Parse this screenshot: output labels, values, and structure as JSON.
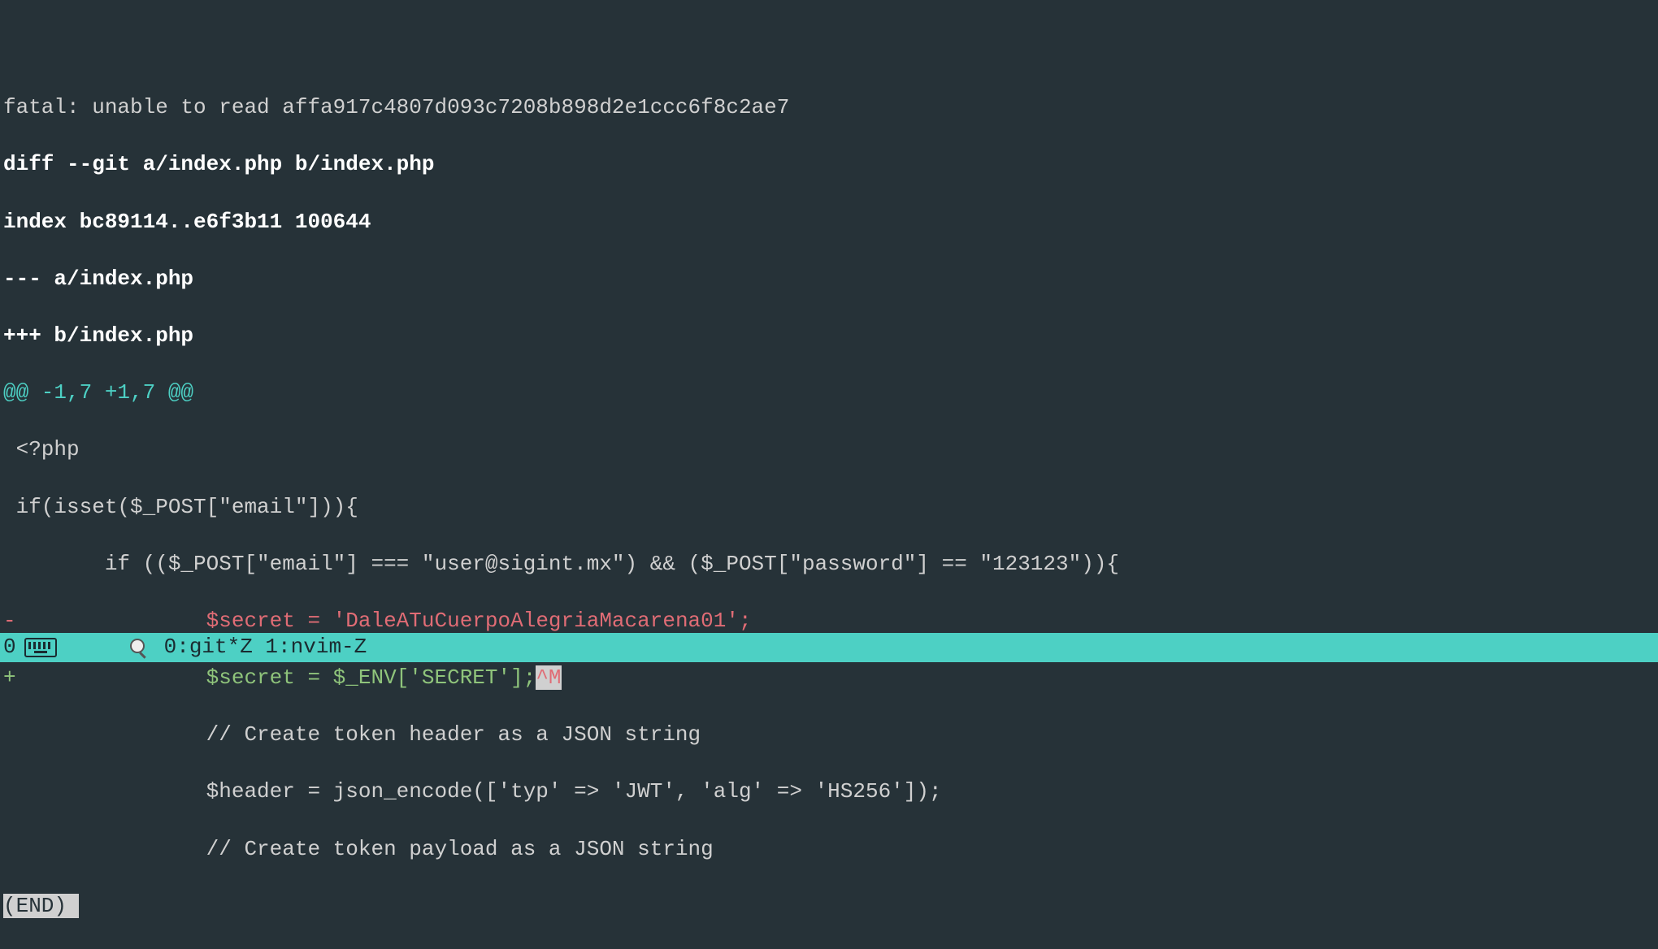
{
  "diff": {
    "fatal_line": "fatal: unable to read affa917c4807d093c7208b898d2e1ccc6f8c2ae7",
    "diff_header": "diff --git a/index.php b/index.php",
    "index_line": "index bc89114..e6f3b11 100644",
    "minus_file": "--- a/index.php",
    "plus_file": "+++ b/index.php",
    "hunk_header": "@@ -1,7 +1,7 @@",
    "context1": " <?php",
    "context2": " if(isset($_POST[\"email\"])){",
    "context3": "        if (($_POST[\"email\"] === \"user@sigint.mx\") && ($_POST[\"password\"] == \"123123\")){",
    "removed_prefix": "-",
    "removed_body": "               $secret = 'DaleATuCuerpoAlegriaMacarena01';",
    "added_prefix": "+",
    "added_body": "               $secret = $_ENV['SECRET'];",
    "ctrlm": "^M",
    "context4": "                // Create token header as a JSON string",
    "context5": "                $header = json_encode(['typ' => 'JWT', 'alg' => 'HS256']);",
    "context6": "                // Create token payload as a JSON string",
    "end_marker": "(END)"
  },
  "status": {
    "session_num": "0",
    "windows": "0:git*Z 1:nvim-Z"
  }
}
